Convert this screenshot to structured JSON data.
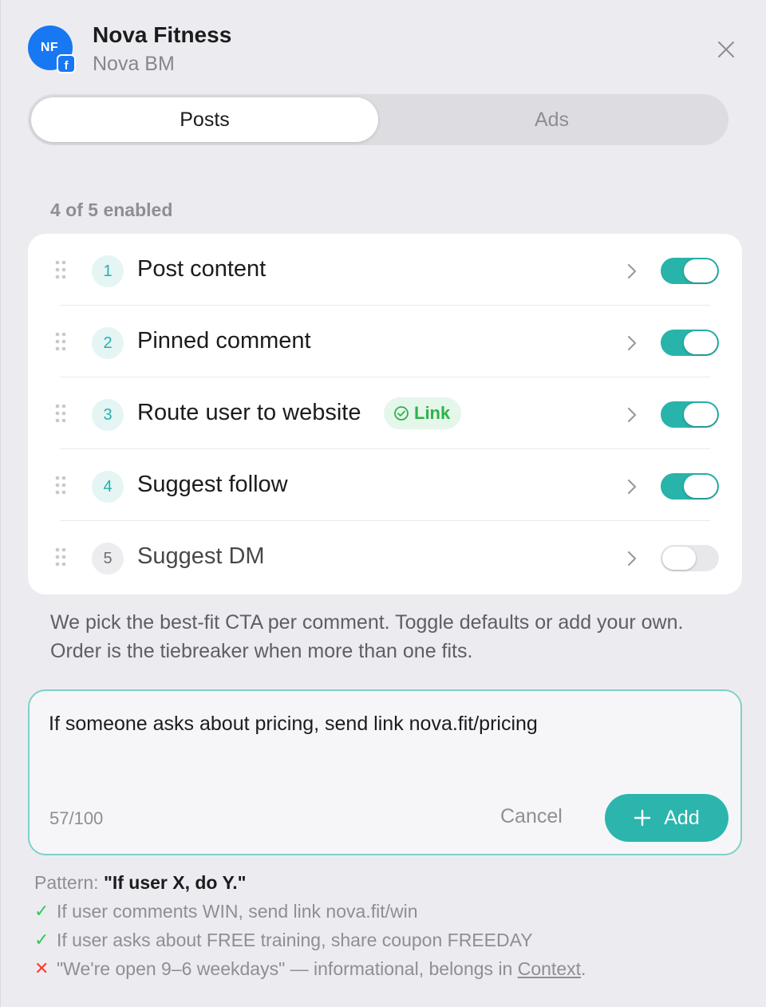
{
  "header": {
    "avatar_initials": "NF",
    "badge_letter": "f",
    "title": "Nova Fitness",
    "subtitle": "Nova BM"
  },
  "tabs": [
    {
      "label": "Posts",
      "active": true
    },
    {
      "label": "Ads",
      "active": false
    }
  ],
  "enabled_count": "4 of 5 enabled",
  "ctas": [
    {
      "number": "1",
      "label": "Post content",
      "enabled": true
    },
    {
      "number": "2",
      "label": "Pinned comment",
      "enabled": true
    },
    {
      "number": "3",
      "label": "Route user to website",
      "enabled": true,
      "badge": "Link"
    },
    {
      "number": "4",
      "label": "Suggest follow",
      "enabled": true
    },
    {
      "number": "5",
      "label": "Suggest DM",
      "enabled": false
    }
  ],
  "helper_text": "We pick the best-fit CTA per comment. Toggle defaults or add your own. Order is the tiebreaker when more than one fits.",
  "input": {
    "value": "If someone asks about pricing, send link nova.fit/pricing",
    "char_count": "57/100",
    "cancel_label": "Cancel",
    "add_label": "Add"
  },
  "pattern": {
    "prefix": "Pattern:",
    "format": "\"If user X, do Y.\"",
    "good_examples": [
      "If user comments WIN, send link nova.fit/win",
      "If user asks about FREE training, share coupon FREEDAY"
    ],
    "bad_example": "\"We're open 9–6 weekdays\" — informational, belongs in",
    "bad_link": "Context",
    "bad_suffix": "."
  },
  "colors": {
    "accent": "#2bb5ad",
    "facebook": "#1877f2",
    "success": "#34c759",
    "error": "#ff3b30"
  }
}
